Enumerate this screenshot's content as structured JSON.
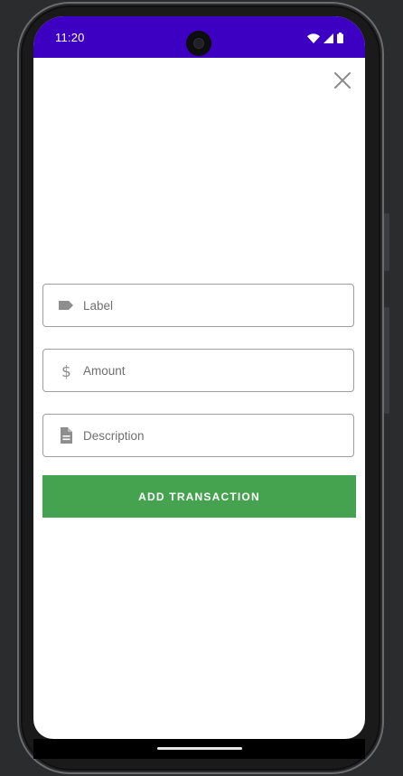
{
  "status_bar": {
    "time": "11:20",
    "background": "#3d00c2",
    "icons": [
      "wifi-icon",
      "cell-signal-icon",
      "battery-icon"
    ]
  },
  "dialog": {
    "close_icon": "close-icon",
    "fields": {
      "label": {
        "placeholder": "Label",
        "value": "",
        "icon": "label-tag-icon"
      },
      "amount": {
        "placeholder": "Amount",
        "value": "",
        "icon": "dollar-icon"
      },
      "description": {
        "placeholder": "Description",
        "value": "",
        "icon": "document-icon"
      }
    },
    "add_button": {
      "label": "ADD TRANSACTION",
      "color": "#45a24e"
    }
  }
}
